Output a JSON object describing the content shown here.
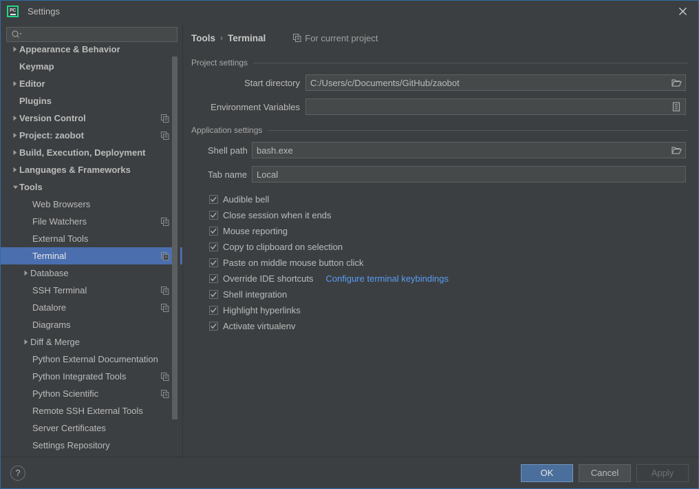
{
  "window": {
    "title": "Settings",
    "app_logo_text": "PC",
    "close_label": "✕"
  },
  "search": {
    "placeholder": "",
    "value": "",
    "icon": "search-icon"
  },
  "sidebar": {
    "items": [
      {
        "label": "Appearance & Behavior",
        "level": 0,
        "arrow": "collapsed",
        "copy_icon": false,
        "selected": false
      },
      {
        "label": "Keymap",
        "level": 0,
        "arrow": "none",
        "copy_icon": false,
        "selected": false
      },
      {
        "label": "Editor",
        "level": 0,
        "arrow": "collapsed",
        "copy_icon": false,
        "selected": false
      },
      {
        "label": "Plugins",
        "level": 0,
        "arrow": "none",
        "copy_icon": false,
        "selected": false
      },
      {
        "label": "Version Control",
        "level": 0,
        "arrow": "collapsed",
        "copy_icon": true,
        "selected": false
      },
      {
        "label": "Project: zaobot",
        "level": 0,
        "arrow": "collapsed",
        "copy_icon": true,
        "selected": false
      },
      {
        "label": "Build, Execution, Deployment",
        "level": 0,
        "arrow": "collapsed",
        "copy_icon": false,
        "selected": false
      },
      {
        "label": "Languages & Frameworks",
        "level": 0,
        "arrow": "collapsed",
        "copy_icon": false,
        "selected": false
      },
      {
        "label": "Tools",
        "level": 0,
        "arrow": "expanded",
        "copy_icon": false,
        "selected": false
      },
      {
        "label": "Web Browsers",
        "level": 1,
        "arrow": "none",
        "copy_icon": false,
        "selected": false
      },
      {
        "label": "File Watchers",
        "level": 1,
        "arrow": "none",
        "copy_icon": true,
        "selected": false
      },
      {
        "label": "External Tools",
        "level": 1,
        "arrow": "none",
        "copy_icon": false,
        "selected": false
      },
      {
        "label": "Terminal",
        "level": 1,
        "arrow": "none",
        "copy_icon": true,
        "selected": true
      },
      {
        "label": "Database",
        "level": 1,
        "arrow": "collapsed",
        "copy_icon": false,
        "selected": false
      },
      {
        "label": "SSH Terminal",
        "level": 1,
        "arrow": "none",
        "copy_icon": true,
        "selected": false
      },
      {
        "label": "Datalore",
        "level": 1,
        "arrow": "none",
        "copy_icon": true,
        "selected": false
      },
      {
        "label": "Diagrams",
        "level": 1,
        "arrow": "none",
        "copy_icon": false,
        "selected": false
      },
      {
        "label": "Diff & Merge",
        "level": 1,
        "arrow": "collapsed",
        "copy_icon": false,
        "selected": false
      },
      {
        "label": "Python External Documentation",
        "level": 1,
        "arrow": "none",
        "copy_icon": false,
        "selected": false
      },
      {
        "label": "Python Integrated Tools",
        "level": 1,
        "arrow": "none",
        "copy_icon": true,
        "selected": false
      },
      {
        "label": "Python Scientific",
        "level": 1,
        "arrow": "none",
        "copy_icon": true,
        "selected": false
      },
      {
        "label": "Remote SSH External Tools",
        "level": 1,
        "arrow": "none",
        "copy_icon": false,
        "selected": false
      },
      {
        "label": "Server Certificates",
        "level": 1,
        "arrow": "none",
        "copy_icon": false,
        "selected": false
      },
      {
        "label": "Settings Repository",
        "level": 1,
        "arrow": "none",
        "copy_icon": false,
        "selected": false
      }
    ]
  },
  "content": {
    "breadcrumb": {
      "parent": "Tools",
      "separator": "›",
      "current": "Terminal"
    },
    "project_badge": {
      "label": "For current project",
      "icon": "copy-icon"
    },
    "project_settings": {
      "section_label": "Project settings",
      "start_directory": {
        "label": "Start directory",
        "value": "C:/Users/c/Documents/GitHub/zaobot",
        "button_icon": "folder-icon"
      },
      "environment_variables": {
        "label": "Environment Variables",
        "value": "",
        "button_icon": "list-icon"
      }
    },
    "application_settings": {
      "section_label": "Application settings",
      "shell_path": {
        "label": "Shell path",
        "value": "bash.exe",
        "button_icon": "folder-icon"
      },
      "tab_name": {
        "label": "Tab name",
        "value": "Local"
      },
      "checkboxes": [
        {
          "label": "Audible bell",
          "checked": true
        },
        {
          "label": "Close session when it ends",
          "checked": true
        },
        {
          "label": "Mouse reporting",
          "checked": true
        },
        {
          "label": "Copy to clipboard on selection",
          "checked": true
        },
        {
          "label": "Paste on middle mouse button click",
          "checked": true
        },
        {
          "label": "Override IDE shortcuts",
          "checked": true,
          "link": "Configure terminal keybindings"
        },
        {
          "label": "Shell integration",
          "checked": true
        },
        {
          "label": "Highlight hyperlinks",
          "checked": true
        },
        {
          "label": "Activate virtualenv",
          "checked": true
        }
      ]
    }
  },
  "footer": {
    "help_label": "?",
    "ok_label": "OK",
    "cancel_label": "Cancel",
    "apply_label": "Apply"
  },
  "colors": {
    "window_bg": "#3c3f41",
    "selection_blue": "#4b6eaf",
    "link_blue": "#589df6",
    "primary_button": "#4a6f9c",
    "logo_green": "#21d789",
    "text": "#bbbbbb",
    "border_accent": "#2d6ca8"
  }
}
